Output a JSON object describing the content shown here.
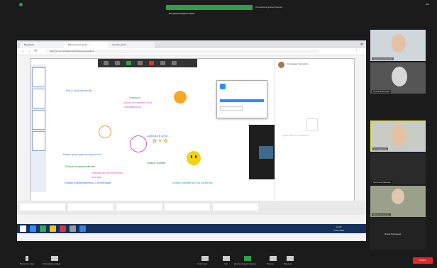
{
  "meeting": {
    "share_status": "Вы демонстрируете экран",
    "stop_share": "Остановить демонстрацию",
    "top_right": "Вид"
  },
  "browser": {
    "tabs": [
      "Входящие",
      "Виртуальная доска – ...",
      "Онлайн-доска ..."
    ],
    "address": "https://zoom.us/whiteboard/share/presentation/..."
  },
  "whiteboard": {
    "texts": [
      {
        "id": "q1",
        "text": "Как у тебя настрой?",
        "color": "#4b7bd6"
      },
      {
        "id": "q2",
        "text": "Хорошо!",
        "color": "#2a8a3a"
      },
      {
        "id": "q3",
        "text": "Было интересно! Всё",
        "color": "#d05ab0"
      },
      {
        "id": "q3b",
        "text": "понравилось",
        "color": "#d05ab0"
      },
      {
        "id": "q4",
        "text": "Суббота в гугле...",
        "color": "#3f6cc7"
      },
      {
        "id": "q5",
        "text": "Какие цели удалось достичь?",
        "color": "#4b7bd6"
      },
      {
        "id": "q6",
        "text": "Получили вдохновение",
        "color": "#2a8a3a"
      },
      {
        "id": "q7",
        "text": "Новые знания",
        "color": "#2a8a3a"
      },
      {
        "id": "q8",
        "text": "Узнала про интересные",
        "color": "#d05ab0"
      },
      {
        "id": "q8b",
        "text": "методы",
        "color": "#d05ab0"
      },
      {
        "id": "q9",
        "text": "Ближе познакомились с коллегами",
        "color": "#3f6cc7"
      },
      {
        "id": "q10",
        "text": "Можно применить на занятиях",
        "color": "#20a7a0"
      }
    ]
  },
  "chat": {
    "sender": "Александр Сергеевич",
    "empty_text": "Здесь пока нет сообщений"
  },
  "participants": [
    {
      "name": "Анастасия Петрова"
    },
    {
      "name": "Ольга Борисова"
    },
    {
      "name": "Е. Смирнова"
    },
    {
      "name": "Наталья Иванова"
    },
    {
      "name": "Мария Кузьмина"
    },
    {
      "name": "Ольга Лисицына"
    }
  ],
  "toolbar": {
    "mute": "Включить звук",
    "video": "Остановить видео",
    "participants": "Участники",
    "chat": "Чат",
    "share": "Демонстрация экрана",
    "record": "Запись",
    "reactions": "Реакции",
    "end": "Выйти"
  },
  "taskbar": {
    "time": "14:07",
    "date": "15.01.2022"
  }
}
